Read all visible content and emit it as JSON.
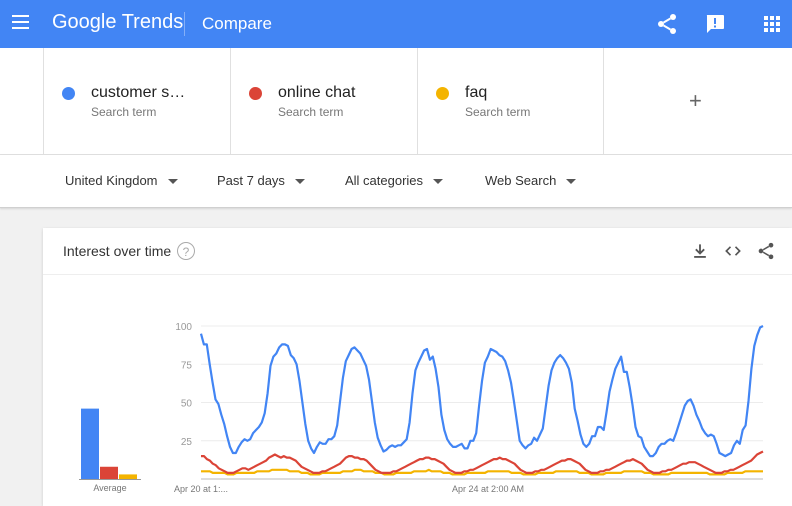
{
  "header": {
    "logo": "Google Trends",
    "page_title": "Compare",
    "icons": [
      "menu-icon",
      "share-icon",
      "feedback-icon",
      "apps-icon"
    ]
  },
  "terms": [
    {
      "name": "customer s…",
      "sub": "Search term",
      "color": "#4285f4"
    },
    {
      "name": "online chat",
      "sub": "Search term",
      "color": "#db4437"
    },
    {
      "name": "faq",
      "sub": "Search term",
      "color": "#f4b400"
    }
  ],
  "add_term_label": "+",
  "filters": {
    "region": "United Kingdom",
    "period": "Past 7 days",
    "category": "All categories",
    "search_type": "Web Search"
  },
  "card": {
    "title": "Interest over time",
    "help": "?",
    "icons": [
      "download-icon",
      "embed-icon",
      "share-icon"
    ]
  },
  "chart_data": {
    "type": "line",
    "ylim": [
      0,
      100
    ],
    "yticks": [
      25,
      50,
      75,
      100
    ],
    "xtick_labels": [
      "Apr 20 at 1:...",
      "Apr 24 at 2:00 AM"
    ],
    "average": {
      "label": "Average",
      "values": [
        46,
        8,
        3
      ]
    },
    "series": [
      {
        "name": "customer s…",
        "color": "#4285f4",
        "values": [
          95,
          88,
          88,
          75,
          63,
          52,
          49,
          42,
          36,
          28,
          21,
          17,
          17,
          21,
          24,
          26,
          25,
          26,
          30,
          32,
          34,
          37,
          43,
          56,
          74,
          80,
          82,
          86,
          88,
          88,
          87,
          81,
          79,
          75,
          64,
          50,
          36,
          25,
          20,
          17,
          21,
          24,
          23,
          23,
          26,
          26,
          28,
          35,
          51,
          66,
          77,
          81,
          85,
          86,
          84,
          82,
          78,
          74,
          65,
          51,
          37,
          27,
          22,
          18,
          19,
          21,
          22,
          21,
          22,
          22,
          24,
          26,
          37,
          56,
          71,
          76,
          80,
          84,
          85,
          78,
          80,
          72,
          60,
          42,
          32,
          26,
          23,
          21,
          21,
          22,
          23,
          20,
          20,
          25,
          25,
          30,
          48,
          64,
          76,
          80,
          85,
          84,
          83,
          81,
          80,
          77,
          71,
          63,
          51,
          38,
          25,
          22,
          20,
          22,
          23,
          27,
          25,
          29,
          33,
          47,
          61,
          71,
          76,
          79,
          81,
          79,
          76,
          72,
          63,
          46,
          38,
          29,
          23,
          21,
          23,
          28,
          28,
          34,
          34,
          32,
          44,
          57,
          65,
          72,
          76,
          80,
          70,
          70,
          60,
          48,
          34,
          28,
          27,
          21,
          18,
          15,
          15,
          17,
          21,
          23,
          23,
          25,
          26,
          25,
          30,
          36,
          42,
          48,
          51,
          52,
          48,
          42,
          38,
          33,
          30,
          28,
          29,
          28,
          23,
          17,
          16,
          15,
          16,
          17,
          22,
          25,
          23,
          32,
          35,
          51,
          72,
          87,
          94,
          99,
          100
        ]
      },
      {
        "name": "online chat",
        "color": "#db4437",
        "values": [
          15,
          15,
          13,
          12,
          10,
          9,
          7,
          6,
          5,
          4,
          4,
          4,
          5,
          6,
          7,
          7,
          6,
          7,
          8,
          9,
          10,
          11,
          12,
          14,
          15,
          16,
          15,
          14,
          15,
          14,
          14,
          13,
          12,
          10,
          8,
          7,
          6,
          5,
          4,
          4,
          4,
          5,
          5,
          6,
          7,
          8,
          9,
          10,
          12,
          14,
          15,
          15,
          14,
          14,
          13,
          13,
          12,
          10,
          8,
          6,
          5,
          4,
          4,
          4,
          4,
          5,
          5,
          6,
          7,
          8,
          9,
          10,
          11,
          12,
          13,
          13,
          14,
          14,
          13,
          13,
          12,
          11,
          10,
          8,
          6,
          5,
          4,
          4,
          4,
          5,
          5,
          6,
          6,
          7,
          8,
          9,
          10,
          11,
          12,
          13,
          13,
          14,
          13,
          13,
          12,
          11,
          10,
          8,
          6,
          5,
          4,
          4,
          4,
          5,
          5,
          6,
          6,
          7,
          8,
          9,
          10,
          11,
          12,
          12,
          13,
          13,
          12,
          11,
          10,
          8,
          6,
          5,
          4,
          4,
          4,
          5,
          5,
          6,
          6,
          7,
          8,
          9,
          10,
          11,
          12,
          12,
          13,
          12,
          11,
          10,
          8,
          6,
          5,
          4,
          4,
          4,
          5,
          5,
          6,
          6,
          7,
          8,
          9,
          10,
          10,
          11,
          11,
          11,
          10,
          9,
          8,
          7,
          6,
          5,
          4,
          4,
          4,
          5,
          5,
          6,
          6,
          7,
          8,
          9,
          10,
          11,
          12,
          14,
          16,
          17,
          18
        ]
      },
      {
        "name": "faq",
        "color": "#f4b400",
        "values": [
          5,
          5,
          5,
          5,
          4,
          4,
          4,
          4,
          4,
          3,
          3,
          3,
          4,
          4,
          4,
          4,
          4,
          4,
          4,
          5,
          5,
          5,
          5,
          5,
          6,
          6,
          6,
          6,
          6,
          6,
          5,
          5,
          5,
          5,
          4,
          4,
          4,
          3,
          3,
          3,
          3,
          4,
          4,
          4,
          4,
          4,
          4,
          4,
          5,
          5,
          5,
          5,
          6,
          6,
          6,
          5,
          5,
          5,
          5,
          4,
          4,
          4,
          3,
          3,
          3,
          3,
          4,
          4,
          4,
          4,
          4,
          4,
          5,
          5,
          5,
          5,
          5,
          6,
          5,
          5,
          5,
          5,
          4,
          4,
          4,
          3,
          3,
          3,
          3,
          3,
          4,
          4,
          4,
          4,
          4,
          4,
          4,
          5,
          5,
          5,
          5,
          5,
          5,
          5,
          5,
          4,
          4,
          4,
          4,
          3,
          3,
          3,
          3,
          3,
          4,
          4,
          4,
          4,
          4,
          4,
          5,
          5,
          5,
          5,
          5,
          5,
          5,
          5,
          4,
          4,
          4,
          4,
          3,
          3,
          3,
          3,
          3,
          4,
          4,
          4,
          4,
          4,
          4,
          5,
          5,
          5,
          5,
          5,
          5,
          5,
          4,
          4,
          4,
          3,
          3,
          3,
          3,
          3,
          3,
          4,
          4,
          4,
          4,
          4,
          4,
          4,
          4,
          4,
          4,
          4,
          4,
          4,
          3,
          3,
          3,
          3,
          3,
          3,
          4,
          4,
          4,
          4,
          4,
          4,
          5,
          5,
          5,
          5,
          5,
          5,
          5
        ]
      }
    ]
  }
}
